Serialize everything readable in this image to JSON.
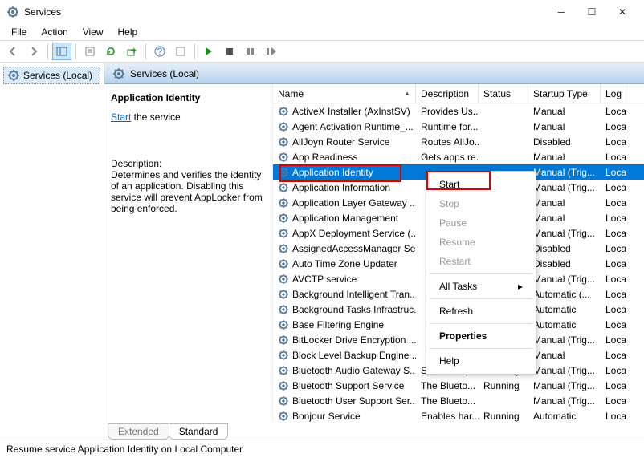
{
  "window": {
    "title": "Services"
  },
  "menu": {
    "file": "File",
    "action": "Action",
    "view": "View",
    "help": "Help"
  },
  "tree": {
    "root": "Services (Local)"
  },
  "header": {
    "title": "Services (Local)"
  },
  "detail": {
    "title": "Application Identity",
    "start_link": "Start",
    "start_after": " the service",
    "desc_label": "Description:",
    "desc_text": "Determines and verifies the identity of an application. Disabling this service will prevent AppLocker from being enforced."
  },
  "columns": {
    "name": "Name",
    "desc": "Description",
    "status": "Status",
    "startup": "Startup Type",
    "logon": "Log"
  },
  "services": [
    {
      "name": "ActiveX Installer (AxInstSV)",
      "desc": "Provides Us...",
      "status": "",
      "startup": "Manual",
      "logon": "Loca"
    },
    {
      "name": "Agent Activation Runtime_...",
      "desc": "Runtime for...",
      "status": "",
      "startup": "Manual",
      "logon": "Loca"
    },
    {
      "name": "AllJoyn Router Service",
      "desc": "Routes AllJo...",
      "status": "",
      "startup": "Disabled",
      "logon": "Loca"
    },
    {
      "name": "App Readiness",
      "desc": "Gets apps re...",
      "status": "",
      "startup": "Manual",
      "logon": "Loca"
    },
    {
      "name": "Application Identity",
      "desc": "",
      "status": "",
      "startup": "Manual (Trig...",
      "logon": "Loca",
      "selected": true
    },
    {
      "name": "Application Information",
      "desc": "",
      "status": "",
      "startup": "Manual (Trig...",
      "logon": "Loca"
    },
    {
      "name": "Application Layer Gateway ...",
      "desc": "",
      "status": "",
      "startup": "Manual",
      "logon": "Loca"
    },
    {
      "name": "Application Management",
      "desc": "",
      "status": "",
      "startup": "Manual",
      "logon": "Loca"
    },
    {
      "name": "AppX Deployment Service (...",
      "desc": "",
      "status": "",
      "startup": "Manual (Trig...",
      "logon": "Loca"
    },
    {
      "name": "AssignedAccessManager Se...",
      "desc": "",
      "status": "",
      "startup": "Disabled",
      "logon": "Loca"
    },
    {
      "name": "Auto Time Zone Updater",
      "desc": "",
      "status": "",
      "startup": "Disabled",
      "logon": "Loca"
    },
    {
      "name": "AVCTP service",
      "desc": "",
      "status": "",
      "startup": "Manual (Trig...",
      "logon": "Loca"
    },
    {
      "name": "Background Intelligent Tran...",
      "desc": "",
      "status": "",
      "startup": "Automatic (...",
      "logon": "Loca"
    },
    {
      "name": "Background Tasks Infrastruc...",
      "desc": "",
      "status": "",
      "startup": "Automatic",
      "logon": "Loca"
    },
    {
      "name": "Base Filtering Engine",
      "desc": "",
      "status": "",
      "startup": "Automatic",
      "logon": "Loca"
    },
    {
      "name": "BitLocker Drive Encryption ...",
      "desc": "",
      "status": "",
      "startup": "Manual (Trig...",
      "logon": "Loca"
    },
    {
      "name": "Block Level Backup Engine ...",
      "desc": "",
      "status": "",
      "startup": "Manual",
      "logon": "Loca"
    },
    {
      "name": "Bluetooth Audio Gateway S...",
      "desc": "Service sup...",
      "status": "Running",
      "startup": "Manual (Trig...",
      "logon": "Loca"
    },
    {
      "name": "Bluetooth Support Service",
      "desc": "The Blueto...",
      "status": "Running",
      "startup": "Manual (Trig...",
      "logon": "Loca"
    },
    {
      "name": "Bluetooth User Support Ser...",
      "desc": "The Blueto...",
      "status": "",
      "startup": "Manual (Trig...",
      "logon": "Loca"
    },
    {
      "name": "Bonjour Service",
      "desc": "Enables har...",
      "status": "Running",
      "startup": "Automatic",
      "logon": "Loca"
    }
  ],
  "ctx": {
    "start": "Start",
    "stop": "Stop",
    "pause": "Pause",
    "resume": "Resume",
    "restart": "Restart",
    "alltasks": "All Tasks",
    "refresh": "Refresh",
    "properties": "Properties",
    "help": "Help"
  },
  "tabs": {
    "extended": "Extended",
    "standard": "Standard"
  },
  "status": {
    "text": "Resume service Application Identity on Local Computer"
  }
}
